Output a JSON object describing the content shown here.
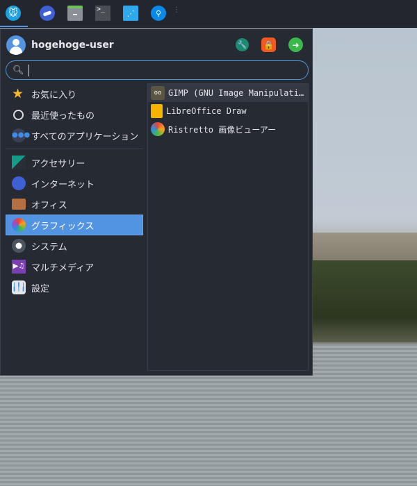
{
  "panel": {
    "launchers": [
      "whisker-menu",
      "web-browser",
      "file-manager",
      "terminal",
      "app-store",
      "app-finder"
    ]
  },
  "menu": {
    "username": "hogehoge-user",
    "search": {
      "value": "",
      "placeholder": ""
    },
    "categories": [
      {
        "label": "お気に入り",
        "icon": "star-icon"
      },
      {
        "label": "最近使ったもの",
        "icon": "clock-icon"
      },
      {
        "label": "すべてのアプリケーション",
        "icon": "all-apps-icon"
      },
      {
        "label": "アクセサリー",
        "icon": "accessories-icon"
      },
      {
        "label": "インターネット",
        "icon": "internet-icon"
      },
      {
        "label": "オフィス",
        "icon": "office-icon"
      },
      {
        "label": "グラフィックス",
        "icon": "graphics-icon",
        "selected": true
      },
      {
        "label": "システム",
        "icon": "system-icon"
      },
      {
        "label": "マルチメディア",
        "icon": "multimedia-icon"
      },
      {
        "label": "設定",
        "icon": "settings-icon"
      }
    ],
    "apps": [
      {
        "label": "GIMP (GNU Image Manipulati…",
        "icon": "gimp-icon"
      },
      {
        "label": "LibreOffice Draw",
        "icon": "libreoffice-draw-icon"
      },
      {
        "label": "Ristretto 画像ビューアー",
        "icon": "ristretto-icon"
      }
    ]
  }
}
